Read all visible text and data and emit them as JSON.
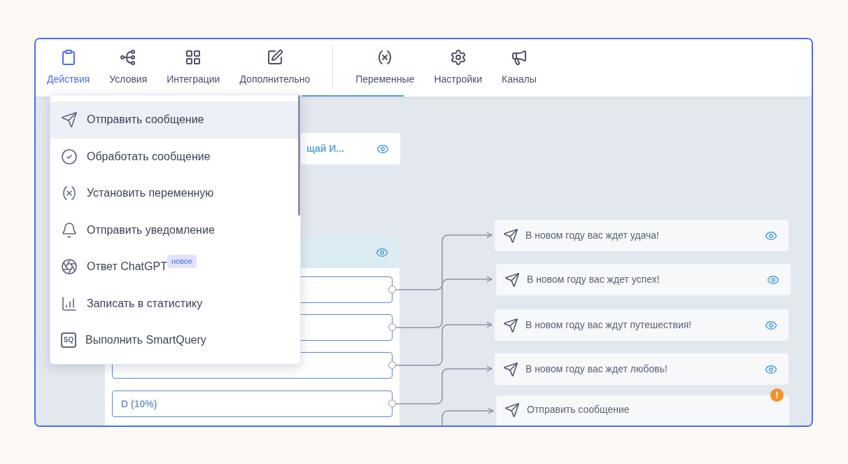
{
  "toolbar": {
    "tabs": [
      {
        "label": "Действия",
        "selected": true
      },
      {
        "label": "Условия",
        "selected": false
      },
      {
        "label": "Интеграции",
        "selected": false
      },
      {
        "label": "Дополнительно",
        "selected": false
      }
    ],
    "tabs_right": [
      {
        "label": "Переменные",
        "selected": false
      },
      {
        "label": "Настройки",
        "selected": false
      },
      {
        "label": "Каналы",
        "selected": false
      }
    ]
  },
  "menu": {
    "items": [
      {
        "label": "Отправить сообщение",
        "selected": true
      },
      {
        "label": "Обработать сообщение",
        "selected": false
      },
      {
        "label": "Установить переменную",
        "selected": false
      },
      {
        "label": "Отправить уведомление",
        "selected": false
      },
      {
        "label": "Ответ ChatGPT",
        "badge": "новое",
        "selected": false
      },
      {
        "label": "Записать в статистику",
        "selected": false
      },
      {
        "label": "Выполнить SmartQuery",
        "icon_text": "SQ",
        "selected": false
      }
    ]
  },
  "canvas": {
    "top_node": {
      "title": "щай И..."
    },
    "split_node": {
      "rows": [
        {
          "label": "D (10%)"
        }
      ]
    },
    "message_nodes": [
      {
        "text": "В новом году вас ждет удача!",
        "preview": true
      },
      {
        "text": "В новом году вас ждет успех!",
        "preview": true
      },
      {
        "text": "В новом году вас ждут путешествия!",
        "preview": true
      },
      {
        "text": "В новом году вас ждет любовь!",
        "preview": true
      },
      {
        "text": "Отправить сообщение",
        "preview": false,
        "warning": "!"
      }
    ]
  }
}
